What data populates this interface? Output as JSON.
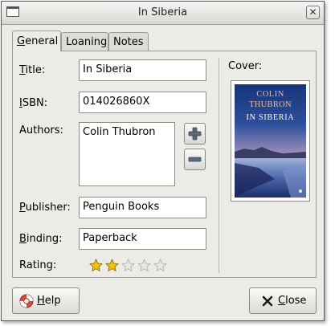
{
  "window": {
    "title": "In Siberia"
  },
  "tabs": [
    {
      "label": "General",
      "mnemonic": "G",
      "rest": "eneral",
      "active": true
    },
    {
      "label": "Loaning",
      "active": false
    },
    {
      "label": "Notes",
      "active": false
    }
  ],
  "form": {
    "title": {
      "label": "Title:",
      "mnemonic": "T",
      "rest": "itle:",
      "value": "In Siberia"
    },
    "isbn": {
      "label": "ISBN:",
      "mnemonic": "I",
      "rest": "SBN:",
      "value": "014026860X"
    },
    "authors": {
      "label": "Authors:",
      "items": [
        "Colin Thubron"
      ]
    },
    "publisher": {
      "label": "Publisher:",
      "mnemonic": "P",
      "rest": "ublisher:",
      "value": "Penguin Books"
    },
    "binding": {
      "label": "Binding:",
      "mnemonic": "B",
      "rest": "inding:",
      "value": "Paperback"
    },
    "rating": {
      "label": "Rating:",
      "value": 2,
      "max": 5
    }
  },
  "cover": {
    "label": "Cover:",
    "author_text": "COLIN THUBRON",
    "author_line1": "COLIN",
    "author_line2": "THUBRON",
    "title_text": "IN SIBERIA"
  },
  "buttons": {
    "help": {
      "label": "Help",
      "mnemonic": "H",
      "rest": "elp"
    },
    "close": {
      "label": "Close",
      "mnemonic": "C",
      "rest": "lose"
    }
  },
  "colors": {
    "star_filled": "#f2c410",
    "star_empty": "#e8e7e3",
    "cover_sky": "#1d3a7a"
  }
}
